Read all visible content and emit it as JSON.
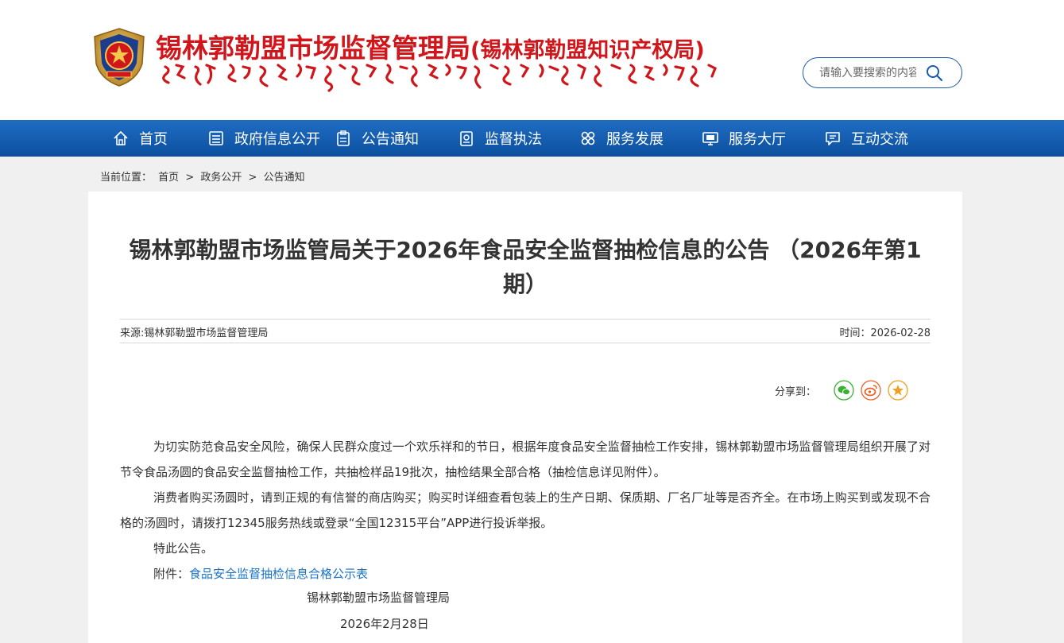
{
  "header": {
    "title_main": "锡林郭勒盟市场监督管理局",
    "title_sub": "(锡林郭勒盟知识产权局)",
    "search_placeholder": "请输入要搜索的内容"
  },
  "colors": {
    "brand_red": "#d0161b",
    "nav_blue": "#0c4f9f",
    "link_blue": "#1a73c8"
  },
  "nav": {
    "items": [
      {
        "label": "首页",
        "icon": "home-icon"
      },
      {
        "label": "政府信息公开",
        "icon": "document-list-icon"
      },
      {
        "label": "公告通知",
        "icon": "clipboard-icon"
      },
      {
        "label": "监督执法",
        "icon": "badge-icon"
      },
      {
        "label": "服务发展",
        "icon": "grid-icon"
      },
      {
        "label": "服务大厅",
        "icon": "monitor-icon"
      },
      {
        "label": "互动交流",
        "icon": "chat-icon"
      }
    ]
  },
  "breadcrumb": {
    "label": "当前位置：",
    "items": [
      "首页",
      "政务公开",
      "公告通知"
    ],
    "separator": ">"
  },
  "article": {
    "title": "锡林郭勒盟市场监管局关于2026年食品安全监督抽检信息的公告 （2026年第1期）",
    "source": "来源:锡林郭勒盟市场监督管理局",
    "time": "时间：2026-02-28",
    "share_label": "分享到：",
    "share_icons": [
      "wechat-icon",
      "weibo-icon",
      "favorite-star-icon"
    ],
    "paragraphs": [
      "为切实防范食品安全风险，确保人民群众度过一个欢乐祥和的节日，根据年度食品安全监督抽检工作安排，锡林郭勒盟市场监督管理局组织开展了对节令食品汤圆的食品安全监督抽检工作，共抽检样品19批次，抽检结果全部合格（抽检信息详见附件）。",
      "消费者购买汤圆时，请到正规的有信誉的商店购买；购买时详细查看包装上的生产日期、保质期、厂名厂址等是否齐全。在市场上购买到或发现不合格的汤圆时，请拨打12345服务热线或登录“全国12315平台”APP进行投诉举报。",
      "特此公告。"
    ],
    "attachment_label": "附件：",
    "attachment_link": "食品安全监督抽检信息合格公示表",
    "signature": "锡林郭勒盟市场监督管理局",
    "date": "2026年2月28日"
  }
}
